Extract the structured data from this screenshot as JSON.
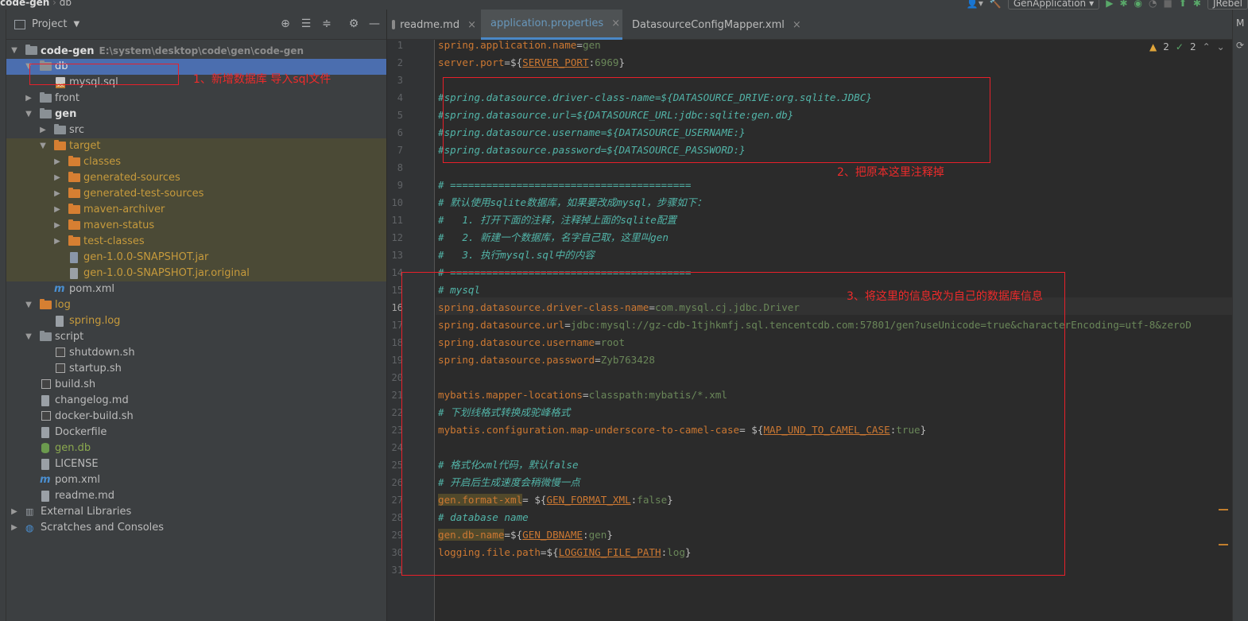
{
  "window": {
    "breadcrumb_project": "code-gen",
    "breadcrumb_folder": "db"
  },
  "toolbar": {
    "run_config": "GenApplication",
    "jrebel_label": "JRebel"
  },
  "project_panel": {
    "title": "Project",
    "rows": [
      {
        "label": "code-gen",
        "path": "E:\\system\\desktop\\code\\gen\\code-gen",
        "bold": true
      },
      {
        "label": "db"
      },
      {
        "label": "mysql.sql"
      },
      {
        "label": "front"
      },
      {
        "label": "gen",
        "bold": true
      },
      {
        "label": "src"
      },
      {
        "label": "target"
      },
      {
        "label": "classes"
      },
      {
        "label": "generated-sources"
      },
      {
        "label": "generated-test-sources"
      },
      {
        "label": "maven-archiver"
      },
      {
        "label": "maven-status"
      },
      {
        "label": "test-classes"
      },
      {
        "label": "gen-1.0.0-SNAPSHOT.jar"
      },
      {
        "label": "gen-1.0.0-SNAPSHOT.jar.original"
      },
      {
        "label": "pom.xml"
      },
      {
        "label": "log"
      },
      {
        "label": "spring.log"
      },
      {
        "label": "script"
      },
      {
        "label": "shutdown.sh"
      },
      {
        "label": "startup.sh"
      },
      {
        "label": "build.sh"
      },
      {
        "label": "changelog.md"
      },
      {
        "label": "docker-build.sh"
      },
      {
        "label": "Dockerfile"
      },
      {
        "label": "gen.db"
      },
      {
        "label": "LICENSE"
      },
      {
        "label": "pom.xml"
      },
      {
        "label": "readme.md"
      },
      {
        "label": "External Libraries"
      },
      {
        "label": "Scratches and Consoles"
      }
    ]
  },
  "tabs": [
    {
      "label": "readme.md"
    },
    {
      "label": "application.properties"
    },
    {
      "label": "DatasourceConfigMapper.xml"
    }
  ],
  "inspections": {
    "warnings": "2",
    "ok": "2"
  },
  "editor_lines": [
    "spring.application.name=gen",
    "server.port=${SERVER_PORT:6969}",
    "",
    "#spring.datasource.driver-class-name=${DATASOURCE_DRIVE:org.sqlite.JDBC}",
    "#spring.datasource.url=${DATASOURCE_URL:jdbc:sqlite:gen.db}",
    "#spring.datasource.username=${DATASOURCE_USERNAME:}",
    "#spring.datasource.password=${DATASOURCE_PASSWORD:}",
    "",
    "# ========================================",
    "# 默认使用sqlite数据库，如果要改成mysql，步骤如下：",
    "#   1. 打开下面的注释，注释掉上面的sqlite配置",
    "#   2. 新建一个数据库，名字自己取，这里叫gen",
    "#   3. 执行mysql.sql中的内容",
    "# ========================================",
    "# mysql",
    "spring.datasource.driver-class-name=com.mysql.cj.jdbc.Driver",
    "spring.datasource.url=jdbc:mysql://gz-cdb-1tjhkmfj.sql.tencentcdb.com:57801/gen?useUnicode=true&characterEncoding=utf-8&zeroD",
    "spring.datasource.username=root",
    "spring.datasource.password=Zyb763428",
    "",
    "mybatis.mapper-locations=classpath:mybatis/*.xml",
    "# 下划线格式转换成驼峰格式",
    "mybatis.configuration.map-underscore-to-camel-case= ${MAP_UND_TO_CAMEL_CASE:true}",
    "",
    "# 格式化xml代码，默认false",
    "# 开启后生成速度会稍微慢一点",
    "gen.format-xml= ${GEN_FORMAT_XML:false}",
    "# database name",
    "gen.db-name=${GEN_DBNAME:gen}",
    "logging.file.path=${LOGGING_FILE_PATH:log}",
    ""
  ],
  "annotations": {
    "step1": "1、新增数据库 导入sql文件",
    "step2": "2、把原本这里注释掉",
    "step3": "3、将这里的信息改为自己的数据库信息"
  },
  "colors": {
    "selection": "#4b6eaf",
    "annotation_red": "#e8202a",
    "excluded_bg": "#4b4a36",
    "folder_orange": "#d67f32"
  }
}
